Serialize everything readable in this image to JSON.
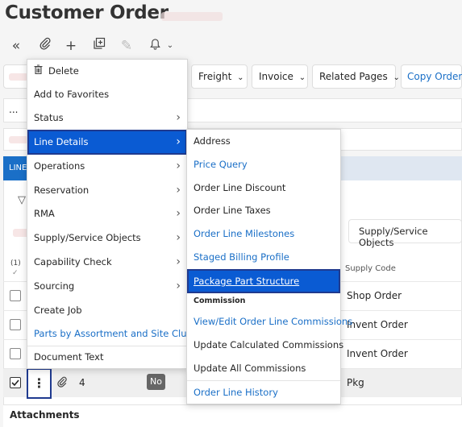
{
  "page": {
    "title": "Customer Order"
  },
  "toolbar": {
    "icons": [
      "double-chevron-left-icon",
      "paperclip-icon",
      "plus-icon",
      "duplicate-icon",
      "pencil-icon",
      "bell-icon",
      "chevron-down-icon"
    ]
  },
  "buttons": {
    "freight": "Freight",
    "invoice": "Invoice",
    "related_pages": "Related Pages",
    "copy_order": "Copy Order"
  },
  "ellipsis": "...",
  "tab": {
    "label": "LINE"
  },
  "table": {
    "count_label": "(1)",
    "supply_code_header": "Supply Code",
    "supply_dropdown": "Supply/Service Objects",
    "rows": [
      {
        "supply_code": "Shop Order"
      },
      {
        "supply_code": "Invent Order"
      },
      {
        "supply_code": "Invent Order"
      },
      {
        "supply_code": "Pkg",
        "attachments": "4",
        "badge": "No"
      }
    ]
  },
  "attachments_label": "Attachments",
  "context_menu": {
    "items": [
      {
        "label": "Delete",
        "icon": "trash-icon"
      },
      {
        "label": "Add to Favorites"
      },
      {
        "label": "Status",
        "submenu": true
      },
      {
        "label": "Line Details",
        "submenu": true,
        "active": true
      },
      {
        "label": "Operations",
        "submenu": true
      },
      {
        "label": "Reservation",
        "submenu": true
      },
      {
        "label": "RMA",
        "submenu": true
      },
      {
        "label": "Supply/Service Objects",
        "submenu": true
      },
      {
        "label": "Capability Check",
        "submenu": true
      },
      {
        "label": "Sourcing",
        "submenu": true
      },
      {
        "label": "Create Job"
      },
      {
        "label": "Parts by Assortment and Site Cluster",
        "link": true
      },
      {
        "label": "Document Text"
      }
    ]
  },
  "submenu": {
    "items": [
      {
        "label": "Address"
      },
      {
        "label": "Price Query",
        "link": true
      },
      {
        "label": "Order Line Discount"
      },
      {
        "label": "Order Line Taxes"
      },
      {
        "label": "Order Line Milestones",
        "link": true
      },
      {
        "label": "Staged Billing Profile",
        "link": true
      },
      {
        "label": "Package Part Structure",
        "active": true
      },
      {
        "label": "Commission",
        "header": true
      },
      {
        "label": "View/Edit Order Line Commissions",
        "link": true
      },
      {
        "label": "Update Calculated Commissions"
      },
      {
        "label": "Update All Commissions"
      },
      {
        "label": "Order Line History",
        "link": true
      }
    ]
  },
  "colors": {
    "accent": "#1a6fc7",
    "menu_active": "#0a5bd3",
    "link": "#1a6fc7"
  }
}
